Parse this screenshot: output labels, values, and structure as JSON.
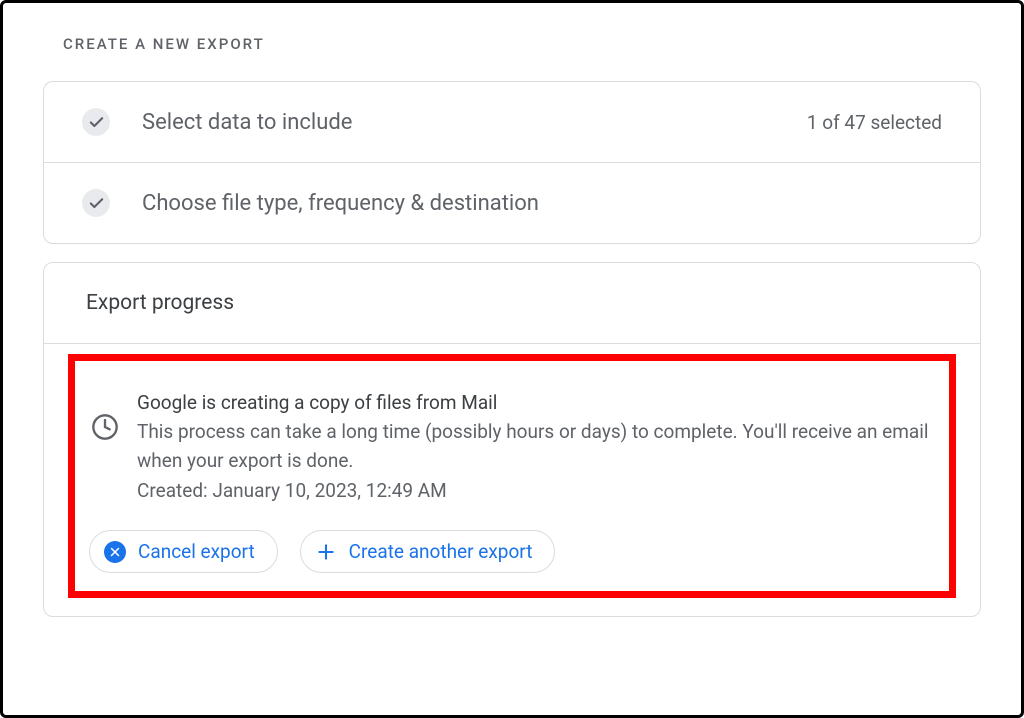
{
  "heading": "CREATE A NEW EXPORT",
  "steps": [
    {
      "title": "Select data to include",
      "meta": "1 of 47 selected"
    },
    {
      "title": "Choose file type, frequency & destination",
      "meta": ""
    }
  ],
  "progress": {
    "header": "Export progress",
    "status_title": "Google is creating a copy of files from Mail",
    "status_desc": "This process can take a long time (possibly hours or days) to complete. You'll receive an email when your export is done.",
    "created_label": "Created: January 10, 2023, 12:49 AM"
  },
  "buttons": {
    "cancel": "Cancel export",
    "create_another": "Create another export"
  }
}
